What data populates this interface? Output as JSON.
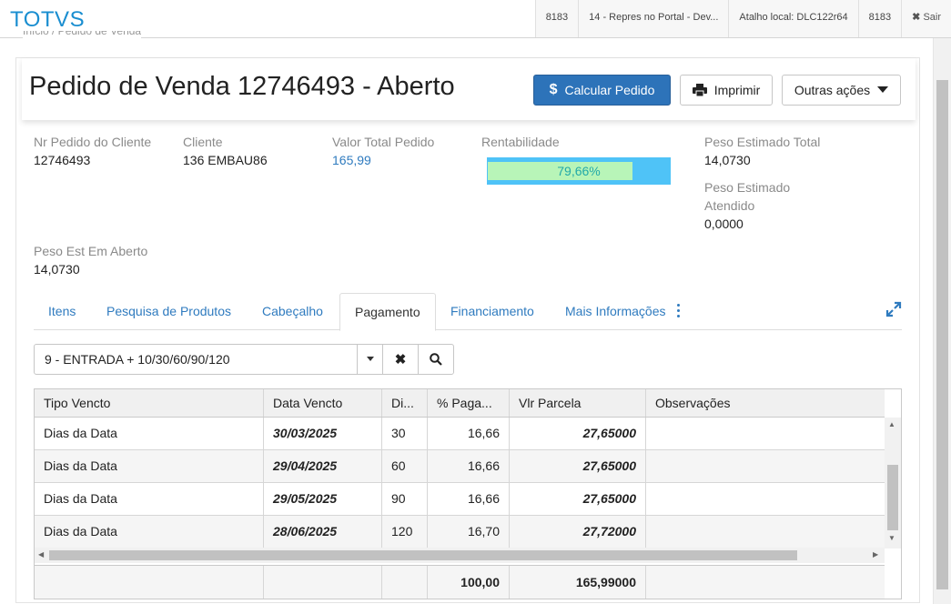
{
  "header": {
    "logo": "TOTVS",
    "info": [
      "8183",
      "14 - Repres no Portal - Dev...",
      "Atalho local: DLC122r64",
      "8183"
    ],
    "exit_label": "Sair"
  },
  "breadcrumb": "Início / Pedido de Venda",
  "page": {
    "title": "Pedido de Venda 12746493 - Aberto",
    "calc_button": "Calcular Pedido",
    "print_button": "Imprimir",
    "more_button": "Outras ações"
  },
  "fields": {
    "nr_pedido_label": "Nr Pedido do Cliente",
    "nr_pedido_value": "12746493",
    "cliente_label": "Cliente",
    "cliente_value": "136 EMBAU86",
    "valor_label": "Valor Total Pedido",
    "valor_value": "165,99",
    "rent_label": "Rentabilidade",
    "rent_value": "79,66%",
    "rent_fraction": 0.7966,
    "peso_total_label": "Peso Estimado Total",
    "peso_total_value": "14,0730",
    "peso_atendido_label_1": "Peso Estimado",
    "peso_atendido_label_2": "Atendido",
    "peso_atendido_value": "0,0000",
    "peso_aberto_label": "Peso Est Em Aberto",
    "peso_aberto_value": "14,0730"
  },
  "tabs": [
    "Itens",
    "Pesquisa de Produtos",
    "Cabeçalho",
    "Pagamento",
    "Financiamento",
    "Mais Informações"
  ],
  "active_tab": "Pagamento",
  "payment_condition": "9 - ENTRADA + 10/30/60/90/120",
  "grid": {
    "columns": [
      "Tipo Vencto",
      "Data Vencto",
      "Di...",
      "% Paga...",
      "Vlr Parcela",
      "Observações"
    ],
    "rows": [
      {
        "tipo": "Dias da Data",
        "data": "30/03/2025",
        "dias": "30",
        "pct": "16,66",
        "valor": "27,65000",
        "obs": ""
      },
      {
        "tipo": "Dias da Data",
        "data": "29/04/2025",
        "dias": "60",
        "pct": "16,66",
        "valor": "27,65000",
        "obs": ""
      },
      {
        "tipo": "Dias da Data",
        "data": "29/05/2025",
        "dias": "90",
        "pct": "16,66",
        "valor": "27,65000",
        "obs": ""
      },
      {
        "tipo": "Dias da Data",
        "data": "28/06/2025",
        "dias": "120",
        "pct": "16,70",
        "valor": "27,72000",
        "obs": ""
      }
    ],
    "totals": {
      "pct": "100,00",
      "valor": "165,99000"
    }
  },
  "colors": {
    "brand": "#1a8ed0",
    "primary": "#2d73b9",
    "link": "#2f7bbf",
    "rent_bar": "#4fc3f7",
    "rent_fill": "#b8f5b8"
  }
}
